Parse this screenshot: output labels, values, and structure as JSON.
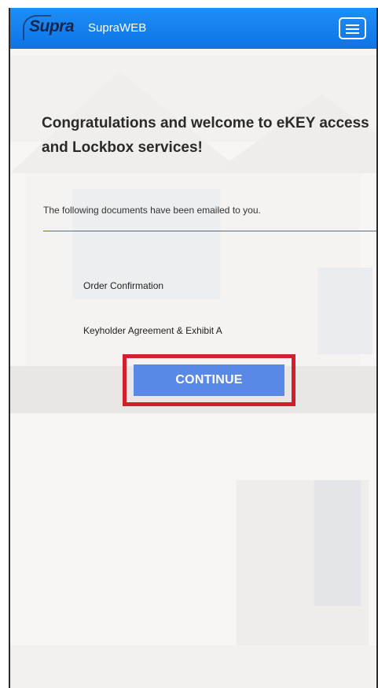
{
  "header": {
    "logo_text": "Supra",
    "app_name": "SupraWEB",
    "menu_icon": "hamburger-menu-icon"
  },
  "main": {
    "title": "Congratulations and welcome to eKEY access and Lockbox services!",
    "intro": "The following documents have been emailed to you.",
    "documents": [
      {
        "label": "Order Confirmation"
      },
      {
        "label": "Keyholder Agreement & Exhibit A"
      }
    ],
    "continue_label": "CONTINUE"
  },
  "colors": {
    "header_blue": "#1281ee",
    "button_blue": "#5a88e6",
    "highlight_red": "#d21f2b",
    "divider_purple": "#5b5bd6"
  }
}
